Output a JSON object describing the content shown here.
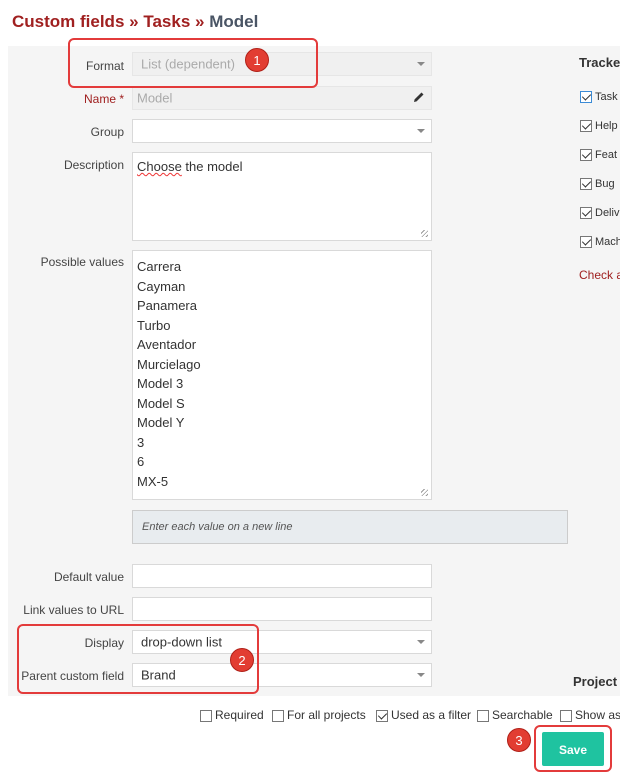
{
  "breadcrumb": {
    "part1": "Custom fields",
    "sep1": "»",
    "part2": "Tasks",
    "sep2": "»",
    "current": "Model"
  },
  "form": {
    "format": {
      "label": "Format",
      "value": "List (dependent)"
    },
    "name": {
      "label": "Name *",
      "value": "Model"
    },
    "group": {
      "label": "Group",
      "value": ""
    },
    "description": {
      "label": "Description",
      "value_word1": "Choose",
      "value_rest": " the model"
    },
    "possible_values": {
      "label": "Possible values",
      "items": [
        "Carrera",
        "Cayman",
        "Panamera",
        "Turbo",
        "Aventador",
        "Murcielago",
        "Model 3",
        "Model S",
        "Model Y",
        "3",
        "6",
        "MX-5"
      ],
      "hint": "Enter each value on a new line"
    },
    "default_value": {
      "label": "Default value",
      "value": ""
    },
    "link_values": {
      "label": "Link values to URL",
      "value": ""
    },
    "display": {
      "label": "Display",
      "value": "drop-down list"
    },
    "parent_field": {
      "label": "Parent custom field",
      "value": "Brand"
    }
  },
  "trackers": {
    "heading": "Tracke",
    "items": [
      {
        "label": "Task",
        "checked": true
      },
      {
        "label": "Help",
        "checked": true
      },
      {
        "label": "Feat",
        "checked": true
      },
      {
        "label": "Bug",
        "checked": true
      },
      {
        "label": "Deliv",
        "checked": true
      },
      {
        "label": "Mach",
        "checked": true
      }
    ],
    "check_all": "Check a"
  },
  "projects": {
    "heading": "Project"
  },
  "options": {
    "required": {
      "label": "Required",
      "checked": false
    },
    "for_all_projects": {
      "label": "For all projects",
      "checked": false
    },
    "used_as_filter": {
      "label": "Used as a filter",
      "checked": true
    },
    "searchable": {
      "label": "Searchable",
      "checked": false
    },
    "show_as": {
      "label": "Show as",
      "checked": false
    }
  },
  "actions": {
    "save_label": "Save"
  },
  "annotations": {
    "badge1": "1",
    "badge2": "2",
    "badge3": "3"
  },
  "colors": {
    "accent_red": "#a02020",
    "save_green": "#1fc3a0",
    "annotation_red": "#e33b3b"
  }
}
